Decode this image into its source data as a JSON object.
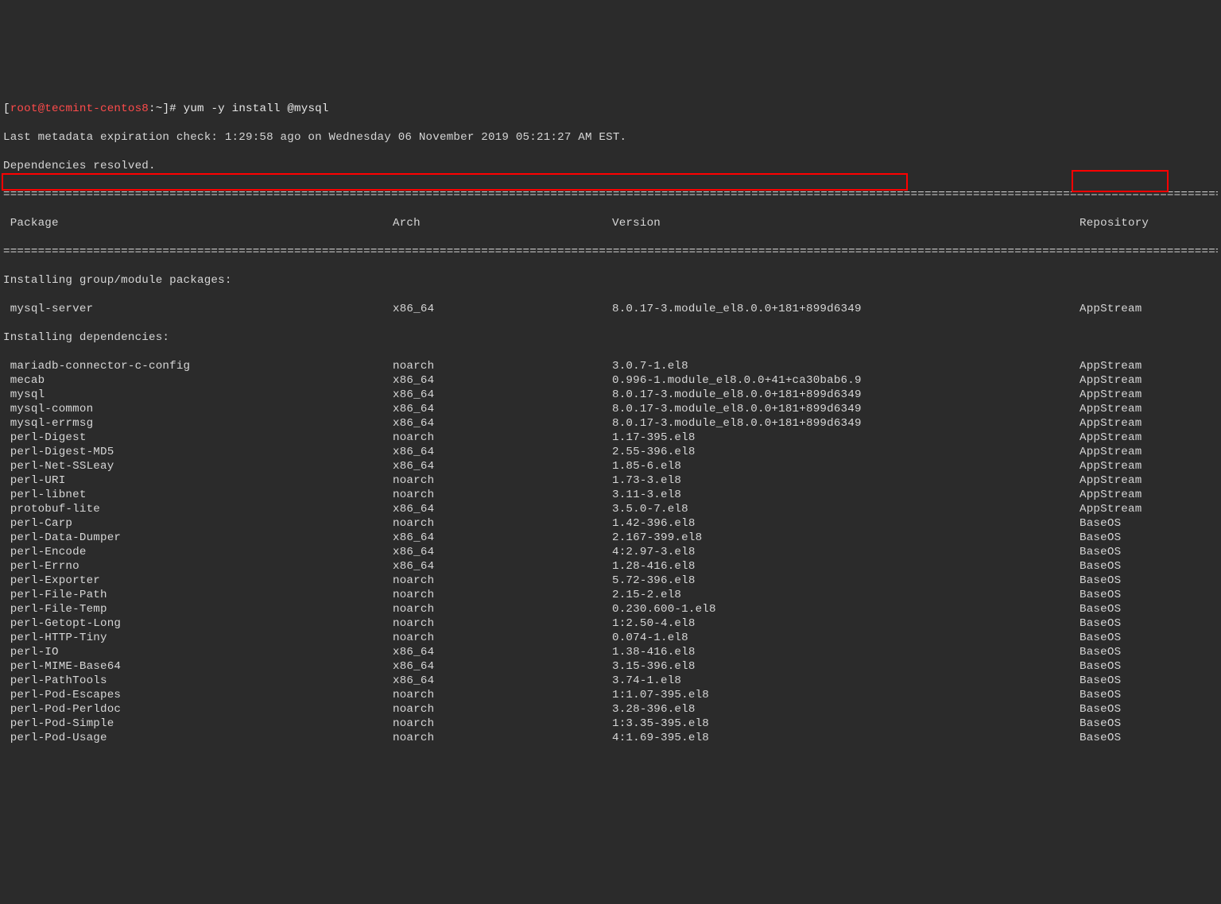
{
  "prompt": {
    "open_bracket": "[",
    "user": "root",
    "at": "@",
    "host": "tecmint-centos8",
    "colon_path": ":~",
    "close_bracket_hash": "]#",
    "command": " yum -y install @mysql"
  },
  "header_lines": [
    "Last metadata expiration check: 1:29:58 ago on Wednesday 06 November 2019 05:21:27 AM EST.",
    "Dependencies resolved."
  ],
  "separator": "====================================================================================================================================================================================",
  "table_header": {
    "package": " Package",
    "arch": "Arch",
    "version": "Version",
    "repository": "Repository"
  },
  "section1_title": "Installing group/module packages:",
  "section2_title": "Installing dependencies:",
  "highlight_row": {
    "package": " mysql-server",
    "arch": "x86_64",
    "version": "8.0.17-3.module_el8.0.0+181+899d6349",
    "repository": "AppStream"
  },
  "dep_rows": [
    {
      "package": " mariadb-connector-c-config",
      "arch": "noarch",
      "version": "3.0.7-1.el8",
      "repository": "AppStream"
    },
    {
      "package": " mecab",
      "arch": "x86_64",
      "version": "0.996-1.module_el8.0.0+41+ca30bab6.9",
      "repository": "AppStream"
    },
    {
      "package": " mysql",
      "arch": "x86_64",
      "version": "8.0.17-3.module_el8.0.0+181+899d6349",
      "repository": "AppStream"
    },
    {
      "package": " mysql-common",
      "arch": "x86_64",
      "version": "8.0.17-3.module_el8.0.0+181+899d6349",
      "repository": "AppStream"
    },
    {
      "package": " mysql-errmsg",
      "arch": "x86_64",
      "version": "8.0.17-3.module_el8.0.0+181+899d6349",
      "repository": "AppStream"
    },
    {
      "package": " perl-Digest",
      "arch": "noarch",
      "version": "1.17-395.el8",
      "repository": "AppStream"
    },
    {
      "package": " perl-Digest-MD5",
      "arch": "x86_64",
      "version": "2.55-396.el8",
      "repository": "AppStream"
    },
    {
      "package": " perl-Net-SSLeay",
      "arch": "x86_64",
      "version": "1.85-6.el8",
      "repository": "AppStream"
    },
    {
      "package": " perl-URI",
      "arch": "noarch",
      "version": "1.73-3.el8",
      "repository": "AppStream"
    },
    {
      "package": " perl-libnet",
      "arch": "noarch",
      "version": "3.11-3.el8",
      "repository": "AppStream"
    },
    {
      "package": " protobuf-lite",
      "arch": "x86_64",
      "version": "3.5.0-7.el8",
      "repository": "AppStream"
    },
    {
      "package": " perl-Carp",
      "arch": "noarch",
      "version": "1.42-396.el8",
      "repository": "BaseOS"
    },
    {
      "package": " perl-Data-Dumper",
      "arch": "x86_64",
      "version": "2.167-399.el8",
      "repository": "BaseOS"
    },
    {
      "package": " perl-Encode",
      "arch": "x86_64",
      "version": "4:2.97-3.el8",
      "repository": "BaseOS"
    },
    {
      "package": " perl-Errno",
      "arch": "x86_64",
      "version": "1.28-416.el8",
      "repository": "BaseOS"
    },
    {
      "package": " perl-Exporter",
      "arch": "noarch",
      "version": "5.72-396.el8",
      "repository": "BaseOS"
    },
    {
      "package": " perl-File-Path",
      "arch": "noarch",
      "version": "2.15-2.el8",
      "repository": "BaseOS"
    },
    {
      "package": " perl-File-Temp",
      "arch": "noarch",
      "version": "0.230.600-1.el8",
      "repository": "BaseOS"
    },
    {
      "package": " perl-Getopt-Long",
      "arch": "noarch",
      "version": "1:2.50-4.el8",
      "repository": "BaseOS"
    },
    {
      "package": " perl-HTTP-Tiny",
      "arch": "noarch",
      "version": "0.074-1.el8",
      "repository": "BaseOS"
    },
    {
      "package": " perl-IO",
      "arch": "x86_64",
      "version": "1.38-416.el8",
      "repository": "BaseOS"
    },
    {
      "package": " perl-MIME-Base64",
      "arch": "x86_64",
      "version": "3.15-396.el8",
      "repository": "BaseOS"
    },
    {
      "package": " perl-PathTools",
      "arch": "x86_64",
      "version": "3.74-1.el8",
      "repository": "BaseOS"
    },
    {
      "package": " perl-Pod-Escapes",
      "arch": "noarch",
      "version": "1:1.07-395.el8",
      "repository": "BaseOS"
    },
    {
      "package": " perl-Pod-Perldoc",
      "arch": "noarch",
      "version": "3.28-396.el8",
      "repository": "BaseOS"
    },
    {
      "package": " perl-Pod-Simple",
      "arch": "noarch",
      "version": "1:3.35-395.el8",
      "repository": "BaseOS"
    },
    {
      "package": " perl-Pod-Usage",
      "arch": "noarch",
      "version": "4:1.69-395.el8",
      "repository": "BaseOS"
    }
  ]
}
